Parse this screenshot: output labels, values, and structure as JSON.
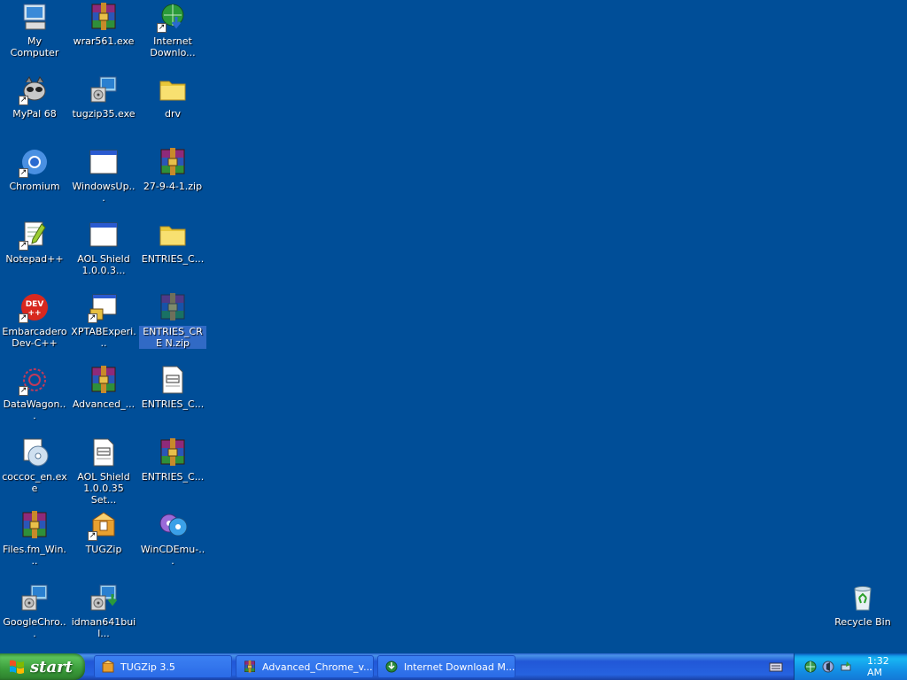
{
  "desktop": {
    "icons": [
      {
        "label": "My Computer",
        "icon": "my-computer-icon"
      },
      {
        "label": "wrar561.exe",
        "icon": "winrar-icon"
      },
      {
        "label": "Internet Downlo...",
        "icon": "idm-icon"
      },
      {
        "label": "MyPal 68",
        "icon": "mypal-icon"
      },
      {
        "label": "tugzip35.exe",
        "icon": "installer-icon"
      },
      {
        "label": "drv",
        "icon": "folder-icon"
      },
      {
        "label": "Chromium",
        "icon": "chromium-icon"
      },
      {
        "label": "WindowsUp...",
        "icon": "window-icon"
      },
      {
        "label": "27-9-4-1.zip",
        "icon": "winrar-icon"
      },
      {
        "label": "Notepad++",
        "icon": "notepadpp-icon"
      },
      {
        "label": "AOL Shield 1.0.0.3...",
        "icon": "window-icon"
      },
      {
        "label": "ENTRIES_C...",
        "icon": "folder-icon"
      },
      {
        "label": "Embarcadero Dev-C++",
        "icon": "devcpp-icon"
      },
      {
        "label": "XPTABExperi...",
        "icon": "xptab-icon"
      },
      {
        "label": "ENTRIES_CRE N.zip",
        "icon": "winrar-icon"
      },
      {
        "label": "DataWagon...",
        "icon": "datawagon-icon"
      },
      {
        "label": "Advanced_...",
        "icon": "winrar-icon"
      },
      {
        "label": "ENTRIES_C...",
        "icon": "text-file-icon"
      },
      {
        "label": "coccoc_en.exe",
        "icon": "cd-installer-icon"
      },
      {
        "label": "AOL Shield 1.0.0.35 Set...",
        "icon": "text-file-icon"
      },
      {
        "label": "ENTRIES_C...",
        "icon": "winrar-icon"
      },
      {
        "label": "Files.fm_Win...",
        "icon": "winrar-icon"
      },
      {
        "label": "TUGZip",
        "icon": "tugzip-icon"
      },
      {
        "label": "WinCDEmu-...",
        "icon": "wincdemu-icon"
      },
      {
        "label": "GoogleChro...",
        "icon": "installer-icon"
      },
      {
        "label": "idman641buil...",
        "icon": "idm-installer-icon"
      }
    ],
    "recycle_bin": {
      "label": "Recycle Bin",
      "icon": "recycle-bin-icon"
    }
  },
  "taskbar": {
    "start_label": "start",
    "tasks": [
      {
        "label": "TUGZip 3.5",
        "icon": "tugzip-icon"
      },
      {
        "label": "Advanced_Chrome_v...",
        "icon": "winrar-icon"
      },
      {
        "label": "Internet Download M...",
        "icon": "idm-icon"
      }
    ],
    "clock": "1:32 AM"
  },
  "colors": {
    "desktop_background": "#004E98",
    "taskbar_blue": "#245EDB",
    "start_green": "#3C9A3C",
    "tray_blue": "#1392E7",
    "selection": "#316AC5"
  }
}
